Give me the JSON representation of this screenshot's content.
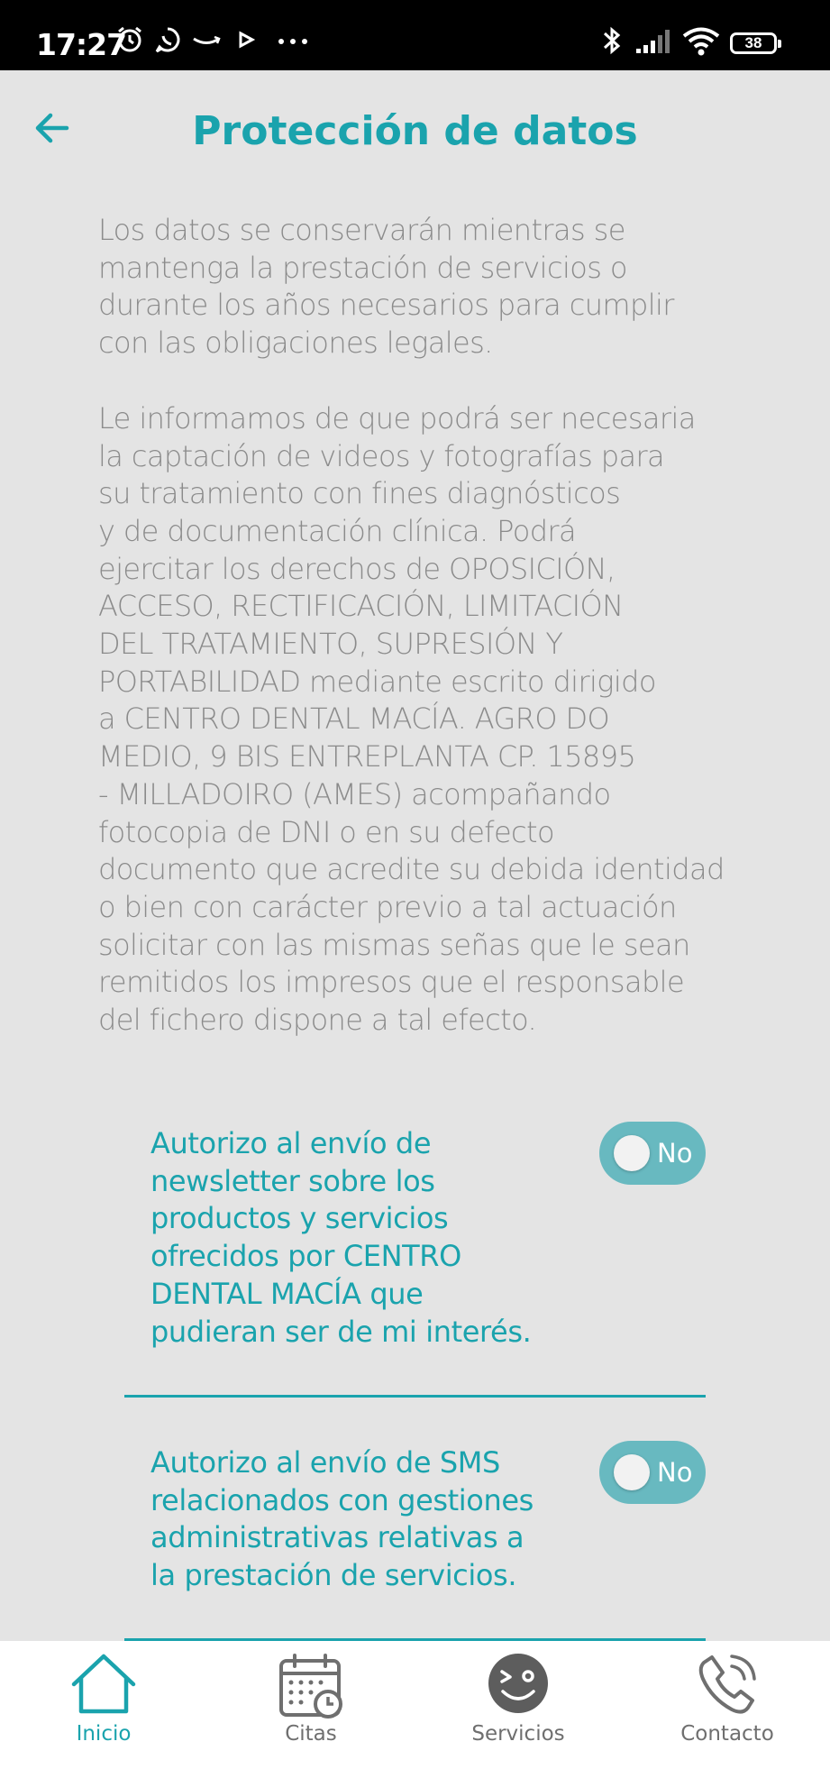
{
  "status_bar": {
    "time": "17:27",
    "battery": "38"
  },
  "header": {
    "title": "Protección de datos"
  },
  "content": {
    "paragraph_1": "Los datos se conservarán mientras se\nmantenga la prestación de servicios o\ndurante los años necesarios para cumplir\ncon las obligaciones legales.",
    "paragraph_2": "Le informamos de que podrá ser necesaria\nla captación de videos y fotografías para\nsu tratamiento con fines diagnósticos\ny de documentación clínica. Podrá\nejercitar los derechos de OPOSICIÓN,\nACCESO, RECTIFICACIÓN, LIMITACIÓN\nDEL TRATAMIENTO, SUPRESIÓN Y\nPORTABILIDAD mediante escrito dirigido\na CENTRO DENTAL MACÍA. AGRO DO\nMEDIO, 9 BIS ENTREPLANTA CP. 15895\n- MILLADOIRO (AMES) acompañando\nfotocopia de DNI o en su defecto\ndocumento que acredite su debida identidad\no bien con carácter previo a tal actuación\nsolicitar con las mismas señas que le sean\nremitidos los impresos que el responsable\ndel fichero dispone a tal efecto."
  },
  "consents": [
    {
      "text": "Autorizo al envío de\nnewsletter sobre los\nproductos y servicios\nofrecidos por CENTRO\nDENTAL MACÍA que\npudieran ser de mi interés.",
      "toggle_label": "No"
    },
    {
      "text": "Autorizo al envío de SMS\nrelacionados con gestiones\nadministrativas relativas a\nla prestación de servicios.",
      "toggle_label": "No"
    }
  ],
  "bottom_nav": {
    "items": [
      {
        "label": "Inicio",
        "icon": "home-icon",
        "active": true
      },
      {
        "label": "Citas",
        "icon": "calendar-icon",
        "active": false
      },
      {
        "label": "Servicios",
        "icon": "smiley-icon",
        "active": false
      },
      {
        "label": "Contacto",
        "icon": "phone-icon",
        "active": false
      }
    ]
  },
  "colors": {
    "accent": "#1aa3ad",
    "toggle_track": "#68b9c0",
    "background": "#e4e4e4",
    "body_text": "#8b8b8b"
  }
}
